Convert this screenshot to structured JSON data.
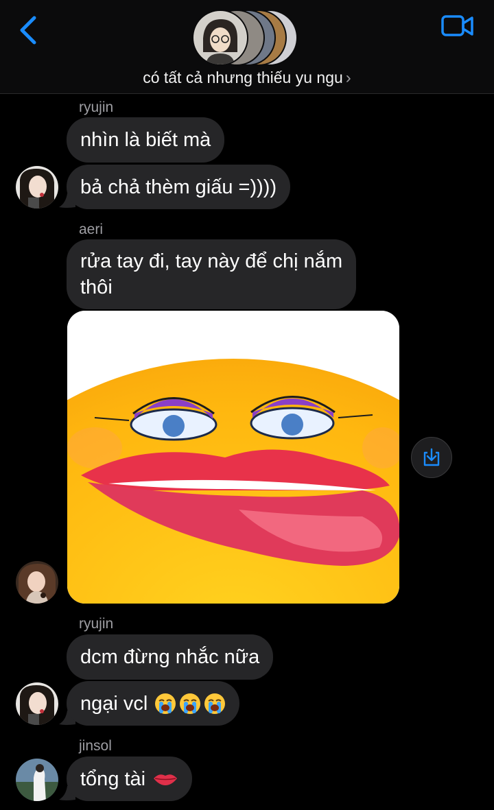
{
  "header": {
    "group_title": "có tất cả nhưng thiếu yu ngu",
    "chevron": "›",
    "back_icon": "chevron-left-icon",
    "video_icon": "video-camera-icon",
    "accent_color": "#1a8cff"
  },
  "messages": [
    {
      "sender": "ryujin",
      "text": "nhìn là biết mà"
    },
    {
      "text": "bả chả thèm giấu =))))"
    },
    {
      "sender": "aeri",
      "text_line1": "rửa tay đi, tay này để chị nắm",
      "text_line2": "thôi"
    },
    {
      "image": "kissing-lips-emoji-meme"
    },
    {
      "sender": "ryujin",
      "text": "dcm đừng nhắc nữa"
    },
    {
      "text": "ngại vcl",
      "emoji": "loudly-crying-face x3"
    },
    {
      "sender": "jinsol",
      "text": "tổng tài",
      "emoji": "lips-emoji"
    }
  ]
}
